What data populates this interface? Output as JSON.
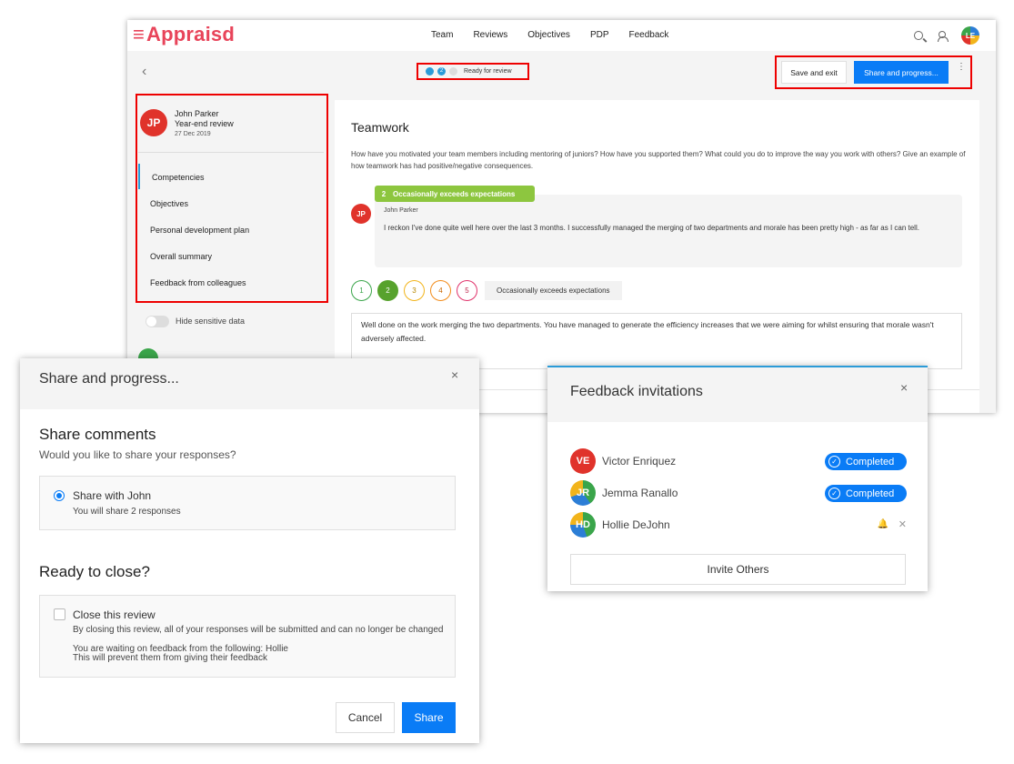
{
  "app": {
    "logo": "Appraisd",
    "logo_mark": "≡"
  },
  "nav": {
    "items": [
      "Team",
      "Reviews",
      "Objectives",
      "PDP",
      "Feedback"
    ],
    "user_initials": "LE"
  },
  "toolbar": {
    "back": "‹",
    "status_text": "Ready for review",
    "step2": "2",
    "save_label": "Save and exit",
    "share_label": "Share and progress...",
    "more": "⋮"
  },
  "sidebar": {
    "person": {
      "initials": "JP",
      "name": "John Parker",
      "review": "Year-end review",
      "date": "27 Dec 2019"
    },
    "items": [
      {
        "label": "Competencies"
      },
      {
        "label": "Objectives"
      },
      {
        "label": "Personal development plan"
      },
      {
        "label": "Overall summary"
      },
      {
        "label": "Feedback from colleagues"
      }
    ],
    "toggle_label": "Hide sensitive data"
  },
  "main": {
    "title": "Teamwork",
    "question": "How have you motivated your team members including mentoring of juniors? How have you supported them? What could you do to improve the way you work with others? Give an example of how teamwork has had positive/negative consequences.",
    "comment": {
      "rating_num": "2",
      "rating_label": "Occasionally exceeds expectations",
      "initials": "JP",
      "author": "John Parker",
      "text": "I reckon I've done quite well here over the last 3 months. I successfully managed the merging of two departments and morale has been pretty high - as far as I can tell."
    },
    "ratings": [
      "1",
      "2",
      "3",
      "4",
      "5"
    ],
    "selected_rating_label": "Occasionally exceeds expectations",
    "feedback": "Well done on the work merging the two departments. You have managed to generate the efficiency increases that we were aiming for whilst ensuring that morale wasn't adversely affected."
  },
  "share_modal": {
    "title": "Share and progress...",
    "close": "×",
    "share_heading": "Share comments",
    "share_sub": "Would you like to share your responses?",
    "share_option": "Share with John",
    "share_option_sub": "You will share 2 responses",
    "close_heading": "Ready to close?",
    "close_option": "Close this review",
    "close_lines": [
      "By closing this review, all of your responses will be submitted and can no longer be changed",
      "You are waiting on feedback from the following: Hollie",
      "This will prevent them from giving their feedback"
    ],
    "cancel": "Cancel",
    "share": "Share"
  },
  "feedback_modal": {
    "title": "Feedback invitations",
    "close": "×",
    "invitees": [
      {
        "initials": "VE",
        "name": "Victor Enriquez",
        "status": "Completed"
      },
      {
        "initials": "JR",
        "name": "Jemma Ranallo",
        "status": "Completed"
      },
      {
        "initials": "HD",
        "name": "Hollie DeJohn",
        "status": ""
      }
    ],
    "invite_label": "Invite Others"
  },
  "colors": {
    "brand": "#e8445a",
    "primary": "#0a7cf6",
    "highlight": "#ee0000",
    "rating": "#8dc63f"
  }
}
